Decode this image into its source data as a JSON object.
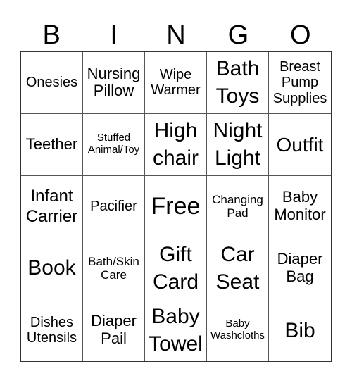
{
  "header": [
    "B",
    "I",
    "N",
    "G",
    "O"
  ],
  "cells": [
    "Onesies",
    "Nursing Pillow",
    "Wipe Warmer",
    "Bath Toys",
    "Breast Pump Supplies",
    "Teether",
    "Stuffed Animal/Toy",
    "High chair",
    "Night Light",
    "Outfit",
    "Infant Carrier",
    "Pacifier",
    "Free",
    "Changing Pad",
    "Baby Monitor",
    "Book",
    "Bath/Skin Care",
    "Gift Card",
    "Car Seat",
    "Diaper Bag",
    "Dishes Utensils",
    "Diaper Pail",
    "Baby Towel",
    "Baby Washcloths",
    "Bib"
  ]
}
